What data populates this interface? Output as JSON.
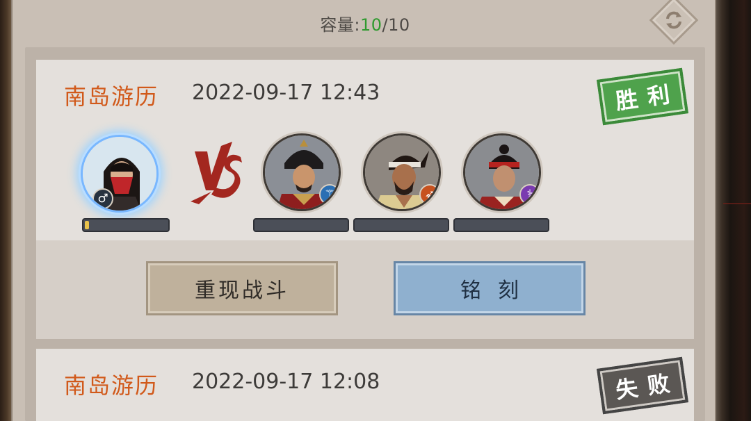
{
  "capacity": {
    "label": "容量:",
    "current": "10",
    "separator": "/",
    "max": "10"
  },
  "refresh_icon": "refresh-arrows-icon",
  "battles": [
    {
      "title": "南岛游历",
      "time": "2022-09-17 12:43",
      "result": "胜利",
      "result_color": "#4fa24c",
      "vs_label": "VS",
      "player": {
        "gender_symbol": "♂",
        "hp_fraction": 0.05
      },
      "enemies": [
        {
          "badge_icon": "trident-icon",
          "badge_color": "#2b6fb3",
          "hp_fraction": 0
        },
        {
          "badge_icon": "bow-icon",
          "badge_color": "#c7521f",
          "hp_fraction": 0
        },
        {
          "badge_icon": "staff-icon",
          "badge_color": "#7a3bb0",
          "hp_fraction": 0
        }
      ],
      "replay_label": "重现战斗",
      "engrave_label": "铭刻"
    },
    {
      "title": "南岛游历",
      "time": "2022-09-17 12:08",
      "result": "失败",
      "result_color": "#5b5754"
    }
  ]
}
